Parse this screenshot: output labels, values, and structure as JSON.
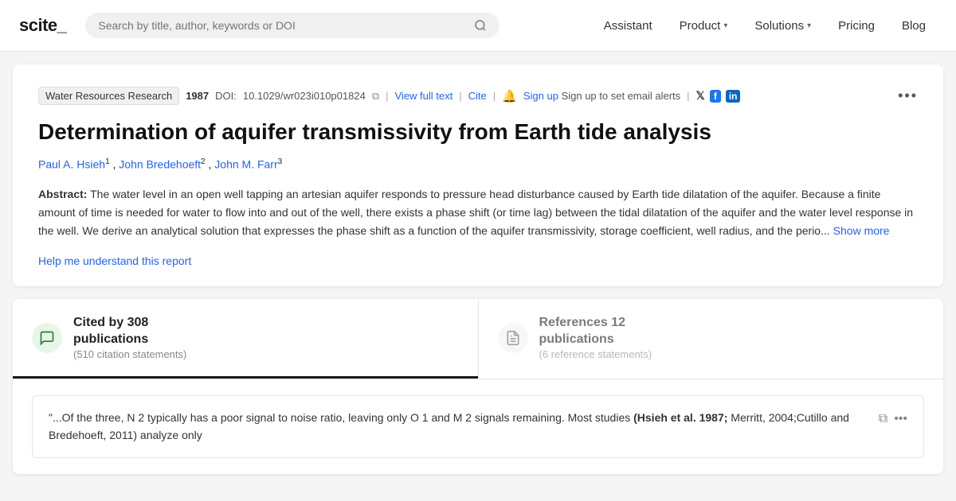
{
  "header": {
    "logo": "scite_",
    "search": {
      "placeholder": "Search by title, author, keywords or DOI"
    },
    "nav": [
      {
        "label": "Assistant",
        "hasChevron": false
      },
      {
        "label": "Product",
        "hasChevron": true
      },
      {
        "label": "Solutions",
        "hasChevron": true
      },
      {
        "label": "Pricing",
        "hasChevron": false
      },
      {
        "label": "Blog",
        "hasChevron": false
      }
    ]
  },
  "article": {
    "journal": "Water Resources Research",
    "year": "1987",
    "doi_label": "DOI:",
    "doi": "10.1029/wr023i010p01824",
    "view_full_text": "View full text",
    "cite": "Cite",
    "alert_text": "Sign up to set email alerts",
    "sign_up": "Sign up",
    "title": "Determination of aquifer transmissivity from Earth tide analysis",
    "authors": [
      {
        "name": "Paul A. Hsieh",
        "sup": "1"
      },
      {
        "name": "John Bredehoeft",
        "sup": "2"
      },
      {
        "name": "John M. Farr",
        "sup": "3"
      }
    ],
    "abstract_label": "Abstract:",
    "abstract_text": "The water level in an open well tapping an artesian aquifer responds to pressure head disturbance caused by Earth tide dilatation of the aquifer. Because a finite amount of time is needed for water to flow into and out of the well, there exists a phase shift (or time lag) between the tidal dilatation of the aquifer and the water level response in the well. We derive an analytical solution that expresses the phase shift as a function of the aquifer transmissivity, storage coefficient, well radius, and the perio...",
    "show_more": "Show more",
    "help_link": "Help me understand this report"
  },
  "citations": {
    "cited_by_label": "Cited by 308 publications",
    "cited_by_main": "Cited by 308",
    "cited_by_sub": "publications",
    "cited_by_stats": "(510 citation statements)",
    "refs_main": "References 12",
    "refs_sub": "publications",
    "refs_stats": "(6 reference statements)",
    "refs_label": "References 12 publications"
  },
  "quote": {
    "text": "\"...Of the three, N 2 typically has a poor signal to noise ratio, leaving only O 1 and M 2 signals remaining. Most studies ",
    "citation": "(Hsieh et al. 1987;",
    "text2": " Merritt, 2004;Cutillo and Bredehoeft, 2011) analyze only"
  },
  "icons": {
    "search": "🔍",
    "bell": "🔔",
    "twitter": "𝕏",
    "facebook": "f",
    "linkedin": "in",
    "copy": "⧉",
    "clipboard": "📋",
    "more": "•••",
    "chat_bubble": "💬",
    "doc": "📄"
  }
}
